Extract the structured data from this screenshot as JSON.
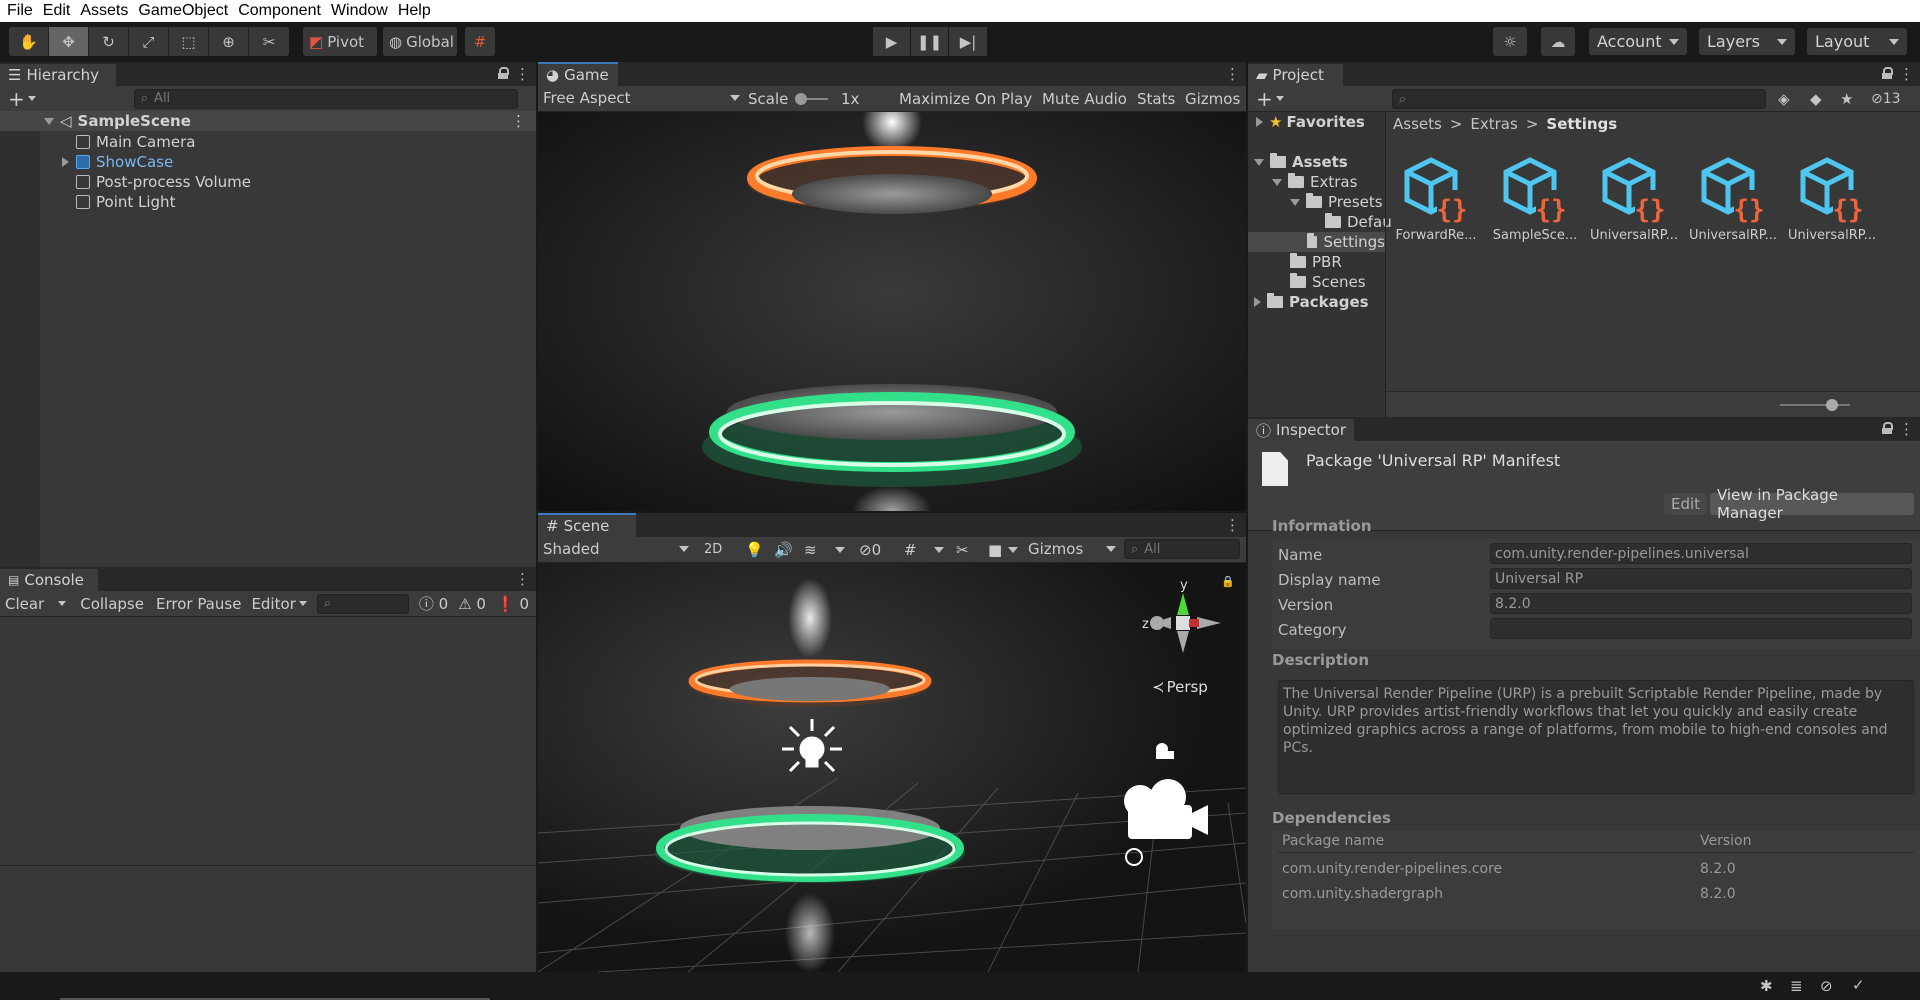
{
  "menu": [
    "File",
    "Edit",
    "Assets",
    "GameObject",
    "Component",
    "Window",
    "Help"
  ],
  "toolbar": {
    "pivot": "Pivot",
    "global": "Global",
    "account": "Account",
    "layers": "Layers",
    "layout": "Layout"
  },
  "hierarchy": {
    "title": "Hierarchy",
    "search_placeholder": "All",
    "scene": "SampleScene",
    "items": [
      "Main Camera",
      "ShowCase",
      "Post-process Volume",
      "Point Light"
    ]
  },
  "game": {
    "title": "Game",
    "aspect": "Free Aspect",
    "scale_label": "Scale",
    "scale_value": "1x",
    "buttons": [
      "Maximize On Play",
      "Mute Audio",
      "Stats",
      "Gizmos"
    ]
  },
  "scene": {
    "title": "Scene",
    "shading": "Shaded",
    "mode2d": "2D",
    "hidden_count": "0",
    "gizmos": "Gizmos",
    "search_placeholder": "All",
    "axis_y": "y",
    "axis_z": "z",
    "persp": "Persp"
  },
  "console": {
    "title": "Console",
    "buttons": [
      "Clear",
      "Collapse",
      "Error Pause",
      "Editor"
    ],
    "log_count": "0",
    "warn_count": "0",
    "error_count": "0"
  },
  "project": {
    "title": "Project",
    "hidden_count": "13",
    "tree": {
      "favorites": "Favorites",
      "assets": "Assets",
      "extras": "Extras",
      "presets": "Presets",
      "default": "Defau",
      "settings": "Settings",
      "pbr": "PBR",
      "scenes": "Scenes",
      "packages": "Packages"
    },
    "breadcrumb": [
      "Assets",
      "Extras",
      "Settings"
    ],
    "files": [
      "ForwardRe...",
      "SampleSce...",
      "UniversalRP...",
      "UniversalRP...",
      "UniversalRP..."
    ]
  },
  "inspector": {
    "title": "Inspector",
    "heading": "Package 'Universal RP' Manifest",
    "edit_button": "Edit",
    "view_button": "View in Package Manager",
    "information_header": "Information",
    "fields": [
      {
        "label": "Name",
        "value": "com.unity.render-pipelines.universal"
      },
      {
        "label": "Display name",
        "value": "Universal RP"
      },
      {
        "label": "Version",
        "value": "8.2.0"
      },
      {
        "label": "Category",
        "value": ""
      }
    ],
    "description_header": "Description",
    "description": "The Universal Render Pipeline (URP) is a prebuilt Scriptable Render Pipeline, made by Unity. URP provides artist-friendly workflows that let you quickly and easily create optimized graphics across a range of platforms, from mobile to high-end consoles and PCs.",
    "dependencies_header": "Dependencies",
    "dep_columns": [
      "Package name",
      "Version"
    ],
    "dependencies": [
      {
        "name": "com.unity.render-pipelines.core",
        "version": "8.2.0"
      },
      {
        "name": "com.unity.shadergraph",
        "version": "8.2.0"
      }
    ]
  },
  "colors": {
    "accent": "#3a79bb",
    "ring_orange": "#ff7a2a",
    "ring_green": "#33e08a",
    "asset_blue": "#4fc6f0",
    "asset_orange": "#f0643a"
  }
}
